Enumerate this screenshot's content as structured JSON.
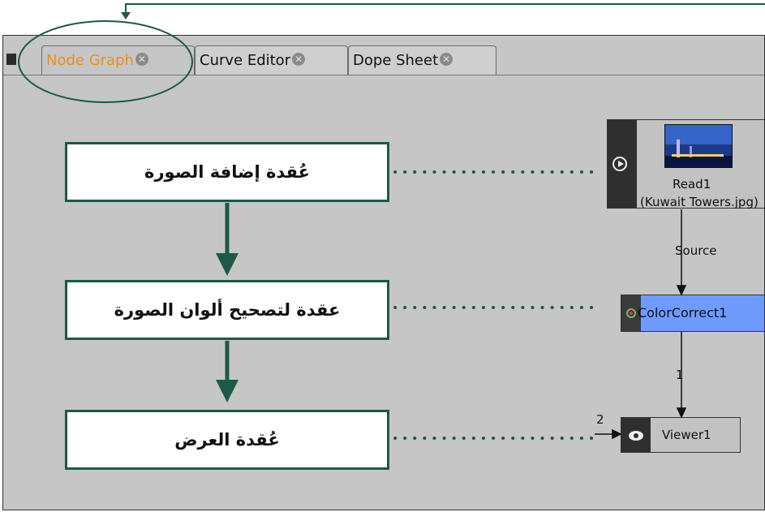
{
  "tabs": [
    {
      "label": "Node Graph",
      "active": true
    },
    {
      "label": "Curve Editor",
      "active": false
    },
    {
      "label": "Dope Sheet",
      "active": false
    }
  ],
  "annotations": {
    "image_node": "عُقدة إضافة الصورة",
    "color_node": "عقدة لتصحيح ألوان الصورة",
    "viewer_node": "عُقدة العرض"
  },
  "nodes": {
    "read": {
      "name": "Read1",
      "file": "(Kuwait Towers.jpg)"
    },
    "color": {
      "name": "ColorCorrect1"
    },
    "viewer": {
      "name": "Viewer1"
    }
  },
  "edges": {
    "read_to_color": "Source",
    "color_to_viewer": "1",
    "viewer_input": "2"
  },
  "colors": {
    "accent_green": "#1e5848",
    "active_tab": "#ef8d1a",
    "node_selected": "#6f9bff"
  }
}
